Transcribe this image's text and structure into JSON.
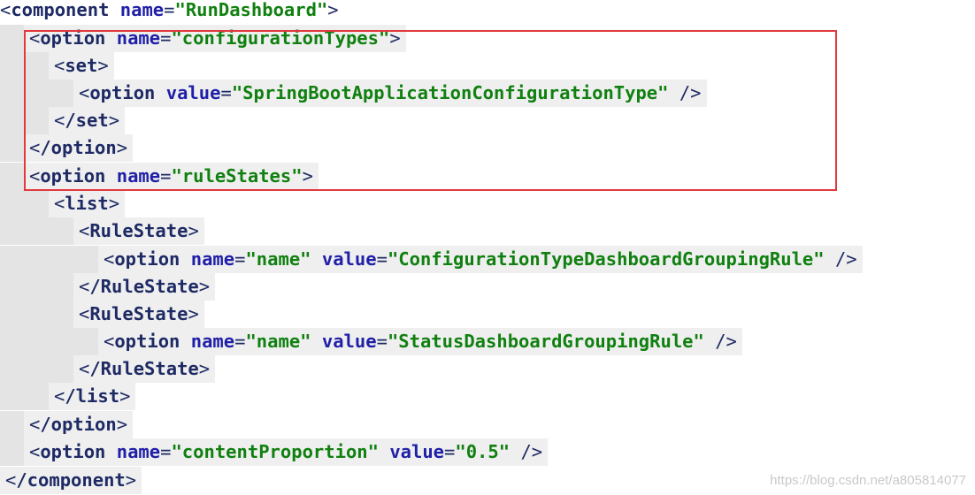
{
  "code": {
    "line1": {
      "tag": "component",
      "attr": "name",
      "value": "\"RunDashboard\""
    },
    "line2": {
      "tag": "option",
      "attr": "name",
      "value": "\"configurationTypes\""
    },
    "line3": {
      "tag": "set"
    },
    "line4": {
      "tag": "option",
      "attr": "value",
      "value": "\"SpringBootApplicationConfigurationType\""
    },
    "line5": {
      "tag": "/set"
    },
    "line6": {
      "tag": "/option"
    },
    "line7": {
      "tag": "option",
      "attr": "name",
      "value": "\"ruleStates\""
    },
    "line8": {
      "tag": "list"
    },
    "line9": {
      "tag": "RuleState"
    },
    "line10": {
      "tag": "option",
      "attr1": "name",
      "value1": "\"name\"",
      "attr2": "value",
      "value2": "\"ConfigurationTypeDashboardGroupingRule\""
    },
    "line11": {
      "tag": "/RuleState"
    },
    "line12": {
      "tag": "RuleState"
    },
    "line13": {
      "tag": "option",
      "attr1": "name",
      "value1": "\"name\"",
      "attr2": "value",
      "value2": "\"StatusDashboardGroupingRule\""
    },
    "line14": {
      "tag": "/RuleState"
    },
    "line15": {
      "tag": "/list"
    },
    "line16": {
      "tag": "/option"
    },
    "line17": {
      "tag": "option",
      "attr1": "name",
      "value1": "\"contentProportion\"",
      "attr2": "value",
      "value2": "\"0.5\""
    },
    "line18": {
      "tag": "/component"
    }
  },
  "watermark": "https://blog.csdn.net/a805814077",
  "colors": {
    "tag": "#1e2a64",
    "attr": "#1f1fa8",
    "value": "#108010",
    "highlight_border": "#e0393e"
  }
}
